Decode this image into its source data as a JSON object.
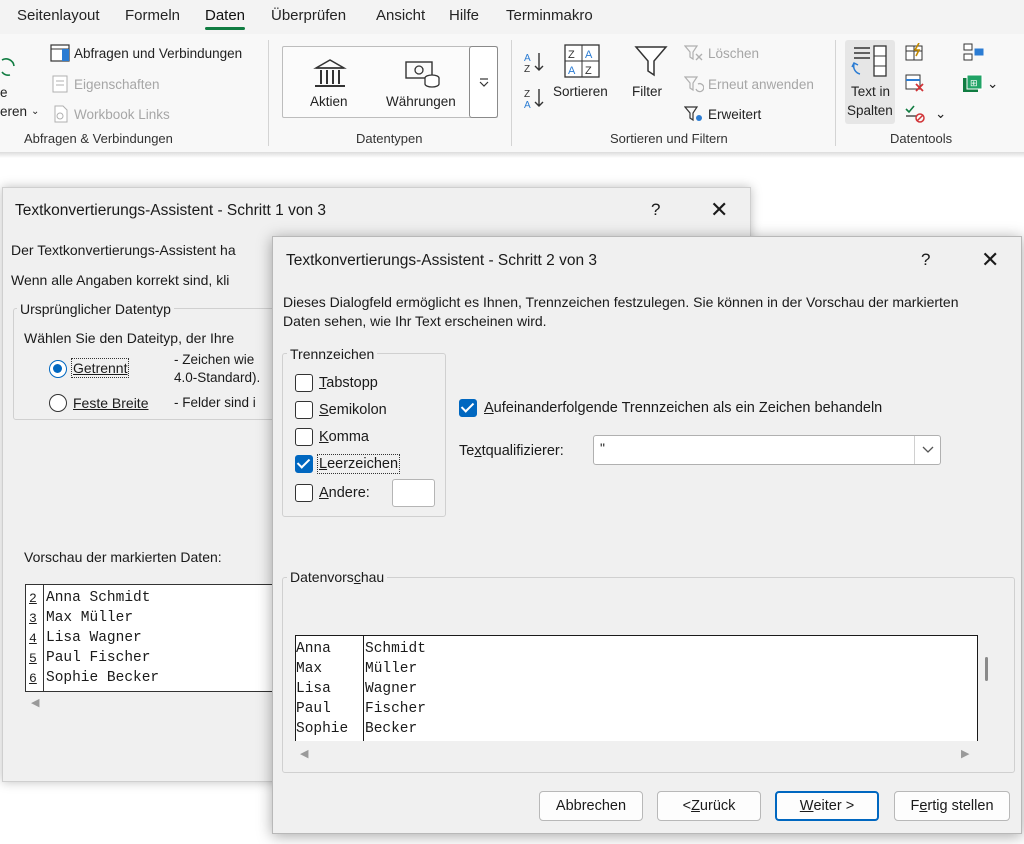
{
  "ribbon": {
    "tabs": [
      "Seitenlayout",
      "Formeln",
      "Daten",
      "Überprüfen",
      "Ansicht",
      "Hilfe",
      "Terminmakro"
    ],
    "active_tab": "Daten",
    "groups": {
      "abfragen": {
        "label": "Abfragen & Verbindungen",
        "cut_left_line1": "e",
        "cut_left_line2": "eren",
        "items": [
          "Abfragen und Verbindungen",
          "Eigenschaften",
          "Workbook Links"
        ]
      },
      "datentypen": {
        "label": "Datentypen",
        "aktien": "Aktien",
        "waehrungen": "Währungen"
      },
      "sortieren": {
        "label": "Sortieren und Filtern",
        "sortieren": "Sortieren",
        "filter": "Filter",
        "loeschen": "Löschen",
        "erneut": "Erneut anwenden",
        "erweitert": "Erweitert"
      },
      "datentools": {
        "label": "Datentools",
        "text_in_spalten_1": "Text in",
        "text_in_spalten_2": "Spalten"
      }
    }
  },
  "dialog1": {
    "title": "Textkonvertierungs-Assistent - Schritt 1 von 3",
    "help": "?",
    "close": "✕",
    "intro1": "Der Textkonvertierungs-Assistent ha",
    "intro2": "Wenn alle Angaben korrekt sind, kli",
    "fieldset_label": "Ursprünglicher Datentyp",
    "choose_label": "Wählen Sie den Dateityp, der Ihre",
    "option_getrennt": "Getrennt",
    "desc_getrennt_1": "- Zeichen wie",
    "desc_getrennt_2": "4.0-Standard).",
    "option_feste": "Feste Breite",
    "desc_feste": "- Felder sind i",
    "preview_label": "Vorschau der markierten Daten:",
    "preview_rows": [
      {
        "num": "2",
        "text": "Anna Schmidt"
      },
      {
        "num": "3",
        "text": "Max Müller"
      },
      {
        "num": "4",
        "text": "Lisa Wagner"
      },
      {
        "num": "5",
        "text": "Paul Fischer"
      },
      {
        "num": "6",
        "text": "Sophie Becker"
      }
    ]
  },
  "dialog2": {
    "title": "Textkonvertierungs-Assistent - Schritt 2 von 3",
    "help": "?",
    "close": "✕",
    "intro": "Dieses Dialogfeld ermöglicht es Ihnen, Trennzeichen festzulegen. Sie können in der Vorschau der markierten Daten sehen, wie Ihr Text erscheinen wird.",
    "trennzeichen_label": "Trennzeichen",
    "delimiters": [
      {
        "pre": "",
        "acc": "T",
        "post": "abstopp",
        "checked": false
      },
      {
        "pre": "",
        "acc": "S",
        "post": "emikolon",
        "checked": false
      },
      {
        "pre": "",
        "acc": "K",
        "post": "omma",
        "checked": false
      },
      {
        "pre": "",
        "acc": "L",
        "post": "eerzeichen",
        "checked": true
      },
      {
        "pre": "",
        "acc": "A",
        "post": "ndere:",
        "checked": false
      }
    ],
    "consecutive_pre": "",
    "consecutive_acc": "A",
    "consecutive_post": "ufeinanderfolgende Trennzeichen als ein Zeichen behandeln",
    "consecutive_checked": true,
    "qualifier_pre": "Te",
    "qualifier_acc": "x",
    "qualifier_post": "tqualifizierer:",
    "qualifier_value": "\"",
    "vorschau_pre": "Datenvors",
    "vorschau_acc": "c",
    "vorschau_post": "hau",
    "preview_rows": [
      [
        "Anna",
        "Schmidt"
      ],
      [
        "Max",
        "Müller"
      ],
      [
        "Lisa",
        "Wagner"
      ],
      [
        "Paul",
        "Fischer"
      ],
      [
        "Sophie",
        "Becker"
      ]
    ],
    "buttons": {
      "abbrechen": "Abbrechen",
      "zurueck_pre": "< ",
      "zurueck_acc": "Z",
      "zurueck_post": "urück",
      "weiter_acc": "W",
      "weiter_post": "eiter >",
      "fertig_pre": "F",
      "fertig_acc": "e",
      "fertig_post": "rtig stellen"
    }
  },
  "colors": {
    "accent_blue": "#0067c0",
    "excel_green": "#107c41",
    "dialog_bg": "#f0f0f0"
  }
}
